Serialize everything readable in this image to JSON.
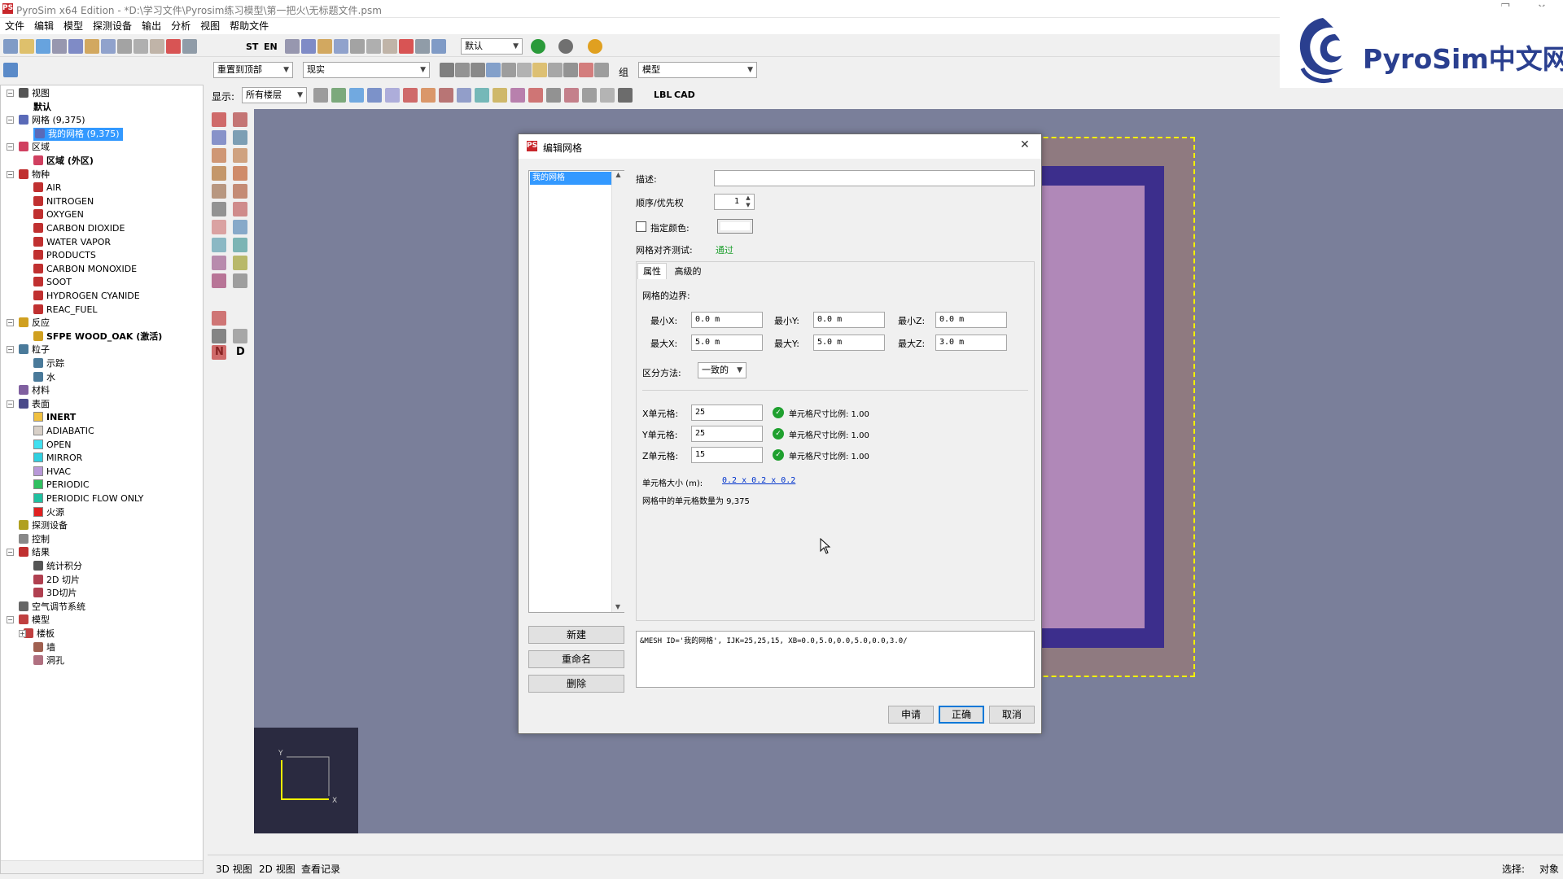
{
  "window": {
    "title": "PyroSim x64 Edition - *D:\\学习文件\\Pyrosim练习模型\\第一把火\\无标题文件.psm",
    "app_icon": "PS"
  },
  "menu": [
    "文件",
    "编辑",
    "模型",
    "探测设备",
    "输出",
    "分析",
    "视图",
    "帮助文件"
  ],
  "toolbar": {
    "st": "ST",
    "en": "EN",
    "default_combo": "默认",
    "reset_label": "重置到顶部",
    "view_mode": "现实",
    "group_label": "组",
    "model_combo": "模型",
    "show_label": "显示:",
    "floor_combo": "所有楼层",
    "lbl": "LBL",
    "cad": "CAD"
  },
  "logo": {
    "text": "PyroSim中文网"
  },
  "tree": [
    {
      "label": "视图",
      "indent": 0,
      "exp": "−",
      "icon": "view"
    },
    {
      "label": "默认",
      "indent": 2,
      "bold": true
    },
    {
      "label": "网格 (9,375)",
      "indent": 0,
      "exp": "−",
      "icon": "mesh"
    },
    {
      "label": "我的网格 (9,375)",
      "indent": 2,
      "sel": true,
      "icon": "mesh"
    },
    {
      "label": "区域",
      "indent": 0,
      "exp": "−",
      "icon": "zone"
    },
    {
      "label": "区域 (外区)",
      "indent": 2,
      "bold": true,
      "icon": "zone"
    },
    {
      "label": "物种",
      "indent": 0,
      "exp": "−",
      "icon": "species"
    },
    {
      "label": "AIR",
      "indent": 2,
      "icon": "species"
    },
    {
      "label": "NITROGEN",
      "indent": 2,
      "icon": "species"
    },
    {
      "label": "OXYGEN",
      "indent": 2,
      "icon": "species"
    },
    {
      "label": "CARBON DIOXIDE",
      "indent": 2,
      "icon": "species"
    },
    {
      "label": "WATER VAPOR",
      "indent": 2,
      "icon": "species"
    },
    {
      "label": "PRODUCTS",
      "indent": 2,
      "icon": "species"
    },
    {
      "label": "CARBON MONOXIDE",
      "indent": 2,
      "icon": "species"
    },
    {
      "label": "SOOT",
      "indent": 2,
      "icon": "species"
    },
    {
      "label": "HYDROGEN CYANIDE",
      "indent": 2,
      "icon": "species"
    },
    {
      "label": "REAC_FUEL",
      "indent": 2,
      "icon": "species"
    },
    {
      "label": "反应",
      "indent": 0,
      "exp": "−",
      "icon": "reaction"
    },
    {
      "label": "SFPE WOOD_OAK (激活)",
      "indent": 2,
      "bold": true,
      "icon": "reaction"
    },
    {
      "label": "粒子",
      "indent": 0,
      "exp": "−",
      "icon": "particle"
    },
    {
      "label": "示踪",
      "indent": 2,
      "icon": "particle"
    },
    {
      "label": "水",
      "indent": 2,
      "icon": "particle"
    },
    {
      "label": "材料",
      "indent": 0,
      "icon": "material"
    },
    {
      "label": "表面",
      "indent": 0,
      "exp": "−",
      "icon": "surface"
    },
    {
      "label": "INERT",
      "indent": 2,
      "swatch": "#f0c040",
      "bold": true
    },
    {
      "label": "ADIABATIC",
      "indent": 2,
      "swatch": "#d8d0c8"
    },
    {
      "label": "OPEN",
      "indent": 2,
      "swatch": "#40e0f0"
    },
    {
      "label": "MIRROR",
      "indent": 2,
      "swatch": "#30d0e0"
    },
    {
      "label": "HVAC",
      "indent": 2,
      "swatch": "#b898d8"
    },
    {
      "label": "PERIODIC",
      "indent": 2,
      "swatch": "#30c060"
    },
    {
      "label": "PERIODIC FLOW ONLY",
      "indent": 2,
      "swatch": "#20c0a0"
    },
    {
      "label": "火源",
      "indent": 2,
      "swatch": "#e02020"
    },
    {
      "label": "探测设备",
      "indent": 0,
      "icon": "device"
    },
    {
      "label": "控制",
      "indent": 0,
      "icon": "control"
    },
    {
      "label": "结果",
      "indent": 0,
      "exp": "−",
      "icon": "output"
    },
    {
      "label": "统计积分",
      "indent": 2,
      "icon": "stat"
    },
    {
      "label": "2D 切片",
      "indent": 2,
      "icon": "slice"
    },
    {
      "label": "3D切片",
      "indent": 2,
      "icon": "slice"
    },
    {
      "label": "空气调节系统",
      "indent": 0,
      "icon": "hvac"
    },
    {
      "label": "模型",
      "indent": 0,
      "exp": "−",
      "icon": "model"
    },
    {
      "label": "楼板",
      "indent": 1,
      "exp": "+",
      "icon": "model"
    },
    {
      "label": "墙",
      "indent": 2,
      "icon": "wall"
    },
    {
      "label": "洞孔",
      "indent": 2,
      "icon": "hole"
    }
  ],
  "vtools": {
    "n": "N",
    "d": "D"
  },
  "status": {
    "tab3d": "3D 视图",
    "tab2d": "2D 视图",
    "tablog": "查看记录",
    "select": "选择:",
    "select_val": "对象"
  },
  "dialog": {
    "title": "编辑网格",
    "list_items": [
      "我的网格"
    ],
    "buttons": {
      "new": "新建",
      "rename": "重命名",
      "delete": "删除",
      "apply": "申请",
      "ok": "正确",
      "cancel": "取消"
    },
    "desc_label": "描述:",
    "desc_value": "",
    "order_label": "顺序/优先权",
    "order_value": "1",
    "color_label": "指定颜色:",
    "align_label": "网格对齐测试:",
    "align_value": "通过",
    "tabs": [
      "属性",
      "高级的"
    ],
    "bounds_label": "网格的边界:",
    "min_x_label": "最小X:",
    "min_x": "0.0 m",
    "min_y_label": "最小Y:",
    "min_y": "0.0 m",
    "min_z_label": "最小Z:",
    "min_z": "0.0 m",
    "max_x_label": "最大X:",
    "max_x": "5.0 m",
    "max_y_label": "最大Y:",
    "max_y": "5.0 m",
    "max_z_label": "最大Z:",
    "max_z": "3.0 m",
    "division_label": "区分方法:",
    "division_value": "一致的",
    "x_cells_label": "X单元格:",
    "x_cells": "25",
    "y_cells_label": "Y单元格:",
    "y_cells": "25",
    "z_cells_label": "Z单元格:",
    "z_cells": "15",
    "ratio_label": "单元格尺寸比例: 1.00",
    "cell_size_label": "单元格大小 (m):",
    "cell_size_value": "0.2 x 0.2 x 0.2",
    "cell_count": "网格中的单元格数量为 9,375",
    "fds_text": "&MESH ID='我的网格', IJK=25,25,15, XB=0.0,5.0,0.0,5.0,0.0,3.0/"
  },
  "colors": {
    "ok_green": "#1fa02f",
    "link_blue": "#0033cc",
    "selection": "#3399ff",
    "mesh_yellow": "#f2f200"
  }
}
